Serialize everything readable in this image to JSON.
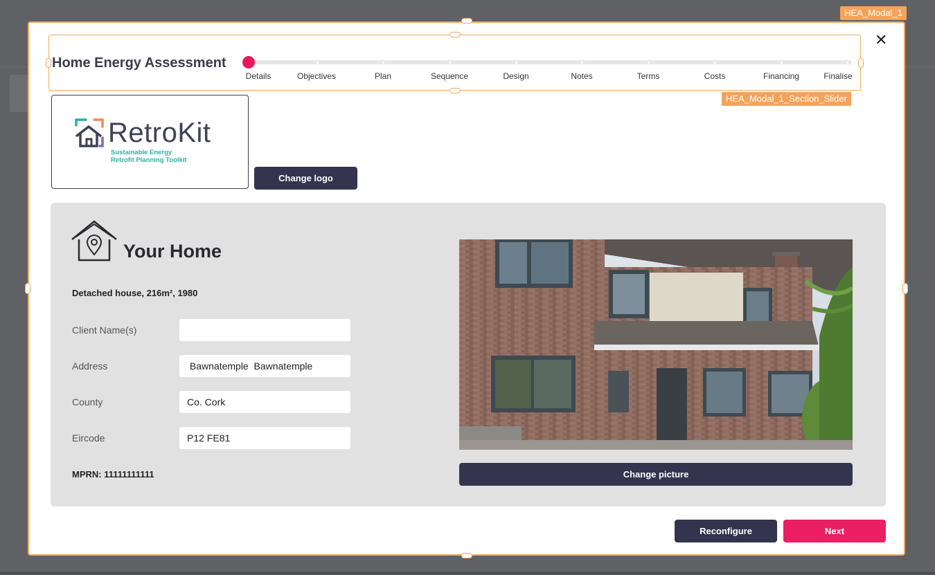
{
  "modal": {
    "tag": "HEA_Modal_1",
    "close_label": "✕",
    "title": "Home Energy Assessment",
    "slider_tag": "HEA_Modal_1_Section_Slider",
    "steps": [
      "Details",
      "Objectives",
      "Plan",
      "Sequence",
      "Design",
      "Notes",
      "Terms",
      "Costs",
      "Financing",
      "Finalise"
    ],
    "current_step": "Details"
  },
  "logo": {
    "name": "RetroKit",
    "tagline_line1": "Sustainable Energy",
    "tagline_line2": "Retrofit Planning Toolkit",
    "change_label": "Change logo"
  },
  "home": {
    "title": "Your Home",
    "description": "Detached house, 216m², 1980",
    "fields": [
      {
        "label": "Client Name(s)",
        "value": ""
      },
      {
        "label": "Address",
        "value": " Bawnatemple  Bawnatemple"
      },
      {
        "label": "County",
        "value": "Co. Cork"
      },
      {
        "label": "Eircode",
        "value": "P12 FE81"
      }
    ],
    "mprn": "MPRN: 11111111111",
    "change_picture_label": "Change picture"
  },
  "footer": {
    "reconfigure_label": "Reconfigure",
    "next_label": "Next"
  },
  "colors": {
    "accent": "#e91e63",
    "dark_button": "#35344f",
    "selection_outline": "#f0a860",
    "panel": "#e2e1e1"
  }
}
